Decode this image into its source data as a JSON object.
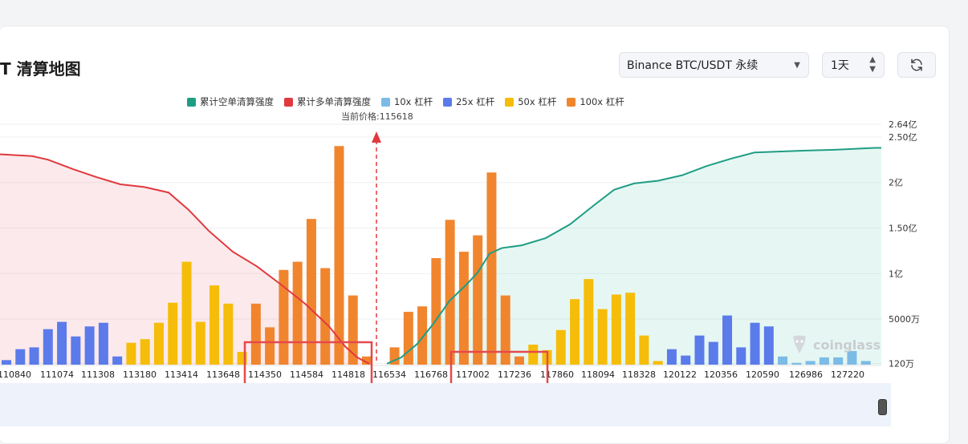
{
  "header": {
    "title": "T 清算地图",
    "exchange_select": "Binance BTC/USDT 永续",
    "timeframe_select": "1天"
  },
  "icons": {
    "exchange_caret": "chevron-down-icon",
    "timeframe_caret": "updown-icon",
    "refresh": "refresh-icon"
  },
  "legend": [
    {
      "label": "累计空单清算强度",
      "color": "#1f9d84"
    },
    {
      "label": "累计多单清算强度",
      "color": "#e03a3e"
    },
    {
      "label": "10x 杠杆",
      "color": "#7cbbe6"
    },
    {
      "label": "25x 杠杆",
      "color": "#5b7bea"
    },
    {
      "label": "50x 杠杆",
      "color": "#f5bd0a"
    },
    {
      "label": "100x 杠杆",
      "color": "#f0852e"
    }
  ],
  "current_price_label": "当前价格:115618",
  "watermark": "coinglass",
  "chart_data": {
    "type": "bar",
    "y_axis": {
      "min": 0,
      "max": 264000000,
      "ticks": [
        "2.64亿",
        "2.50亿",
        "2亿",
        "1.50亿",
        "1亿",
        "5000万",
        "120万"
      ],
      "tick_values": [
        264000000,
        250000000,
        200000000,
        150000000,
        100000000,
        50000000,
        1200000
      ]
    },
    "x_tick_labels": [
      "110840",
      "111074",
      "111308",
      "113180",
      "113414",
      "113648",
      "114350",
      "114584",
      "114818",
      "116534",
      "116768",
      "117002",
      "117236",
      "117860",
      "118094",
      "118328",
      "120122",
      "120356",
      "120590",
      "126986",
      "127220"
    ],
    "current_price": 115618,
    "bars": [
      {
        "lev": "25x",
        "v": 5
      },
      {
        "lev": "25x",
        "v": 17
      },
      {
        "lev": "25x",
        "v": 19
      },
      {
        "lev": "25x",
        "v": 39
      },
      {
        "lev": "25x",
        "v": 47
      },
      {
        "lev": "25x",
        "v": 31
      },
      {
        "lev": "25x",
        "v": 42
      },
      {
        "lev": "25x",
        "v": 46
      },
      {
        "lev": "25x",
        "v": 9
      },
      {
        "lev": "50x",
        "v": 24
      },
      {
        "lev": "50x",
        "v": 28
      },
      {
        "lev": "50x",
        "v": 46
      },
      {
        "lev": "50x",
        "v": 68
      },
      {
        "lev": "50x",
        "v": 113
      },
      {
        "lev": "50x",
        "v": 47
      },
      {
        "lev": "50x",
        "v": 87
      },
      {
        "lev": "50x",
        "v": 67
      },
      {
        "lev": "50x",
        "v": 14
      },
      {
        "lev": "100x",
        "v": 67
      },
      {
        "lev": "100x",
        "v": 41
      },
      {
        "lev": "100x",
        "v": 104
      },
      {
        "lev": "100x",
        "v": 113
      },
      {
        "lev": "100x",
        "v": 160
      },
      {
        "lev": "100x",
        "v": 106
      },
      {
        "lev": "100x",
        "v": 240
      },
      {
        "lev": "100x",
        "v": 76
      },
      {
        "lev": "100x",
        "v": 9
      },
      {
        "lev": "100x",
        "v": 0
      },
      {
        "lev": "100x",
        "v": 19
      },
      {
        "lev": "100x",
        "v": 58
      },
      {
        "lev": "100x",
        "v": 64
      },
      {
        "lev": "100x",
        "v": 117
      },
      {
        "lev": "100x",
        "v": 159
      },
      {
        "lev": "100x",
        "v": 124
      },
      {
        "lev": "100x",
        "v": 142
      },
      {
        "lev": "100x",
        "v": 211
      },
      {
        "lev": "100x",
        "v": 76
      },
      {
        "lev": "100x",
        "v": 9
      },
      {
        "lev": "50x",
        "v": 22
      },
      {
        "lev": "50x",
        "v": 16
      },
      {
        "lev": "50x",
        "v": 38
      },
      {
        "lev": "50x",
        "v": 72
      },
      {
        "lev": "50x",
        "v": 94
      },
      {
        "lev": "50x",
        "v": 61
      },
      {
        "lev": "50x",
        "v": 77
      },
      {
        "lev": "50x",
        "v": 79
      },
      {
        "lev": "50x",
        "v": 32
      },
      {
        "lev": "50x",
        "v": 4
      },
      {
        "lev": "25x",
        "v": 17
      },
      {
        "lev": "25x",
        "v": 10
      },
      {
        "lev": "25x",
        "v": 32
      },
      {
        "lev": "25x",
        "v": 25
      },
      {
        "lev": "25x",
        "v": 54
      },
      {
        "lev": "25x",
        "v": 19
      },
      {
        "lev": "25x",
        "v": 46
      },
      {
        "lev": "25x",
        "v": 42
      },
      {
        "lev": "10x",
        "v": 9
      },
      {
        "lev": "10x",
        "v": 2
      },
      {
        "lev": "10x",
        "v": 4
      },
      {
        "lev": "10x",
        "v": 8
      },
      {
        "lev": "10x",
        "v": 8
      },
      {
        "lev": "10x",
        "v": 15
      },
      {
        "lev": "10x",
        "v": 4
      }
    ],
    "bar_value_unit": "百万",
    "long_cumulative": [
      [
        0,
        231
      ],
      [
        40,
        229
      ],
      [
        60,
        225
      ],
      [
        90,
        215
      ],
      [
        120,
        206
      ],
      [
        150,
        198
      ],
      [
        180,
        195
      ],
      [
        210,
        189
      ],
      [
        235,
        170
      ],
      [
        260,
        147
      ],
      [
        290,
        124
      ],
      [
        320,
        108
      ],
      [
        350,
        88
      ],
      [
        380,
        67
      ],
      [
        410,
        42
      ],
      [
        430,
        20
      ],
      [
        445,
        8
      ],
      [
        460,
        1
      ]
    ],
    "short_cumulative": [
      [
        482,
        1
      ],
      [
        500,
        8
      ],
      [
        520,
        23
      ],
      [
        540,
        45
      ],
      [
        560,
        70
      ],
      [
        580,
        87
      ],
      [
        595,
        101
      ],
      [
        610,
        122
      ],
      [
        625,
        128
      ],
      [
        650,
        131
      ],
      [
        680,
        139
      ],
      [
        710,
        154
      ],
      [
        740,
        175
      ],
      [
        765,
        192
      ],
      [
        790,
        199
      ],
      [
        820,
        202
      ],
      [
        850,
        208
      ],
      [
        880,
        218
      ],
      [
        910,
        226
      ],
      [
        940,
        233
      ],
      [
        970,
        234
      ],
      [
        1000,
        235
      ],
      [
        1040,
        236
      ],
      [
        1090,
        238
      ]
    ]
  },
  "annotations": [
    "box-left-liquidation-zone",
    "box-right-liquidation-zone",
    "current-price-arrow"
  ]
}
